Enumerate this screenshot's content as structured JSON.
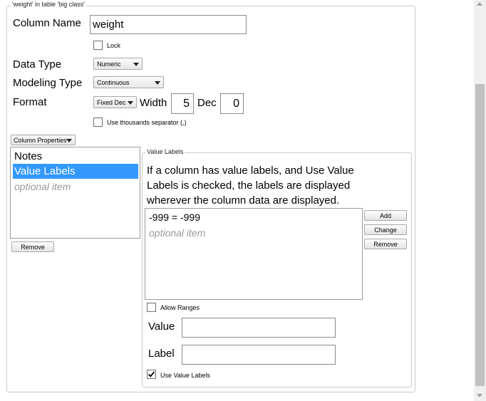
{
  "group_title": "'weight' in table 'big class'",
  "column_name": {
    "label": "Column Name",
    "value": "weight"
  },
  "lock": {
    "label": "Lock",
    "checked": false
  },
  "data_type": {
    "label": "Data Type",
    "value": "Numeric"
  },
  "modeling_type": {
    "label": "Modeling Type",
    "value": "Continuous"
  },
  "format": {
    "label": "Format",
    "value": "Fixed Dec",
    "width_label": "Width",
    "width_value": "5",
    "dec_label": "Dec",
    "dec_value": "0"
  },
  "thousands": {
    "label": "Use thousands separator (,)",
    "checked": false
  },
  "column_properties": {
    "label": "Column Properties",
    "items": [
      "Notes",
      "Value Labels",
      "optional item"
    ],
    "selected": "Value Labels",
    "remove_label": "Remove"
  },
  "value_labels": {
    "title": "Value Labels",
    "desc": [
      "If a column has value labels, and Use Value",
      "Labels is checked, the labels are displayed",
      "wherever the column data are displayed."
    ],
    "list": [
      "-999 = -999",
      "optional item"
    ],
    "add": "Add",
    "change": "Change",
    "remove": "Remove",
    "allow_ranges": {
      "label": "Allow Ranges",
      "checked": false
    },
    "value_label": "Value",
    "value_input": "",
    "label_label": "Label",
    "label_input": "",
    "use_value_labels": {
      "label": "Use Value Labels",
      "checked": true
    }
  },
  "icons": {
    "checkmark": "checkmark-icon",
    "dropdown": "chevron-down-icon",
    "scroll_up": "scroll-up-arrow-icon",
    "scroll_down": "scroll-down-arrow-icon"
  }
}
